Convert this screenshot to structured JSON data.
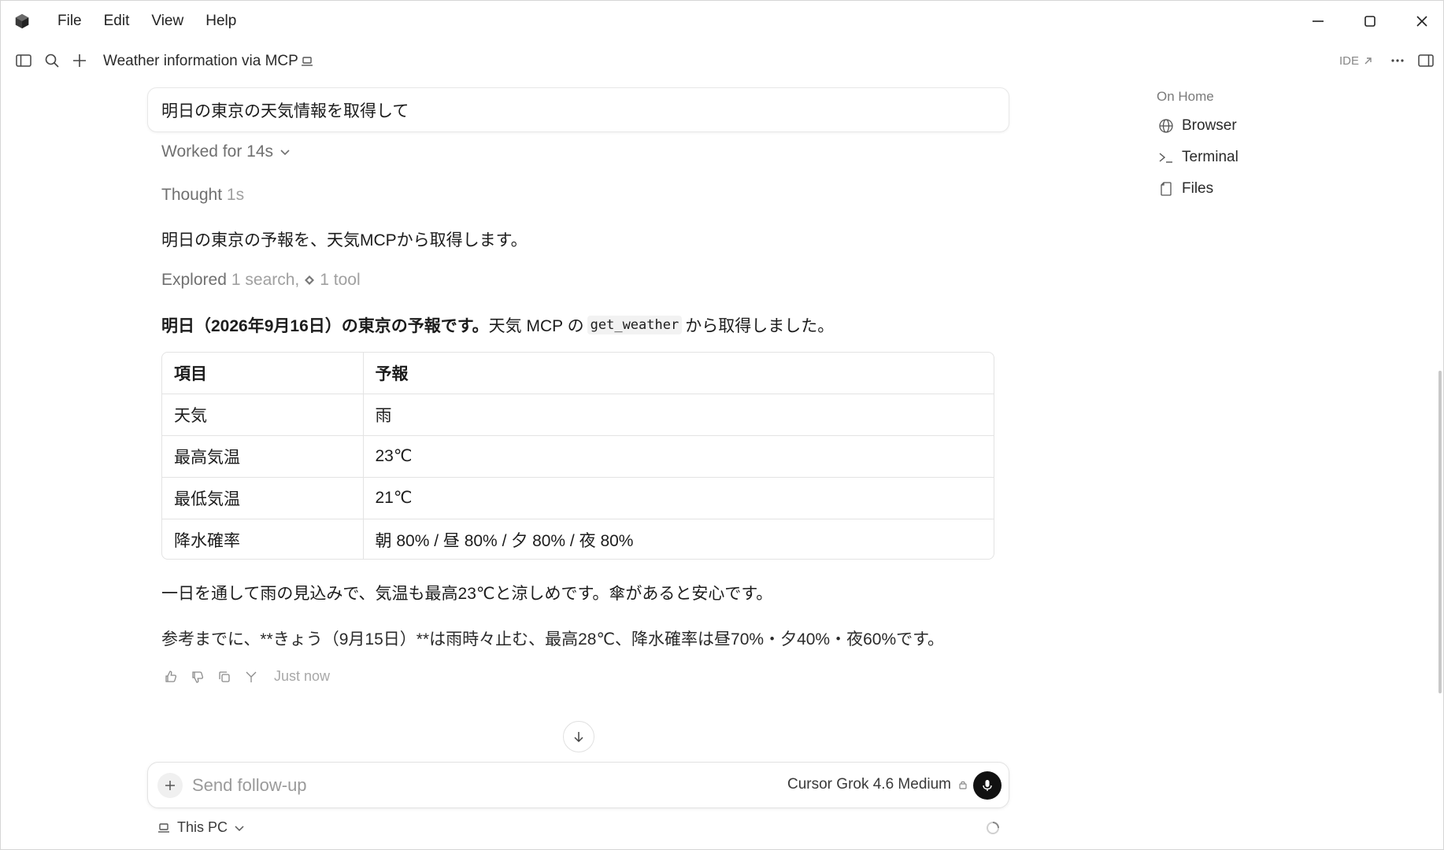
{
  "menubar": {
    "items": [
      "File",
      "Edit",
      "View",
      "Help"
    ]
  },
  "toolbar": {
    "title": "Weather information via MCP",
    "ide_label": "IDE"
  },
  "chat": {
    "prompt": "明日の東京の天気情報を取得して",
    "worked": "Worked for 14s",
    "thought_label": "Thought",
    "thought_duration": "1s",
    "para1": "明日の東京の予報を、天気MCPから取得します。",
    "explored_label": "Explored",
    "explored_search": "1 search,",
    "explored_tool": "1 tool",
    "answer_bold": "明日（2026年9月16日）の東京の予報です。",
    "answer_mid": "天気 MCP の",
    "answer_code": "get_weather",
    "answer_end": "から取得しました。",
    "table": {
      "headers": [
        "項目",
        "予報"
      ],
      "rows": [
        [
          "天気",
          "雨"
        ],
        [
          "最高気温",
          "23℃"
        ],
        [
          "最低気温",
          "21℃"
        ],
        [
          "降水確率",
          "朝 80% / 昼 80% / 夕 80% / 夜 80%"
        ]
      ]
    },
    "para2": "一日を通して雨の見込みで、気温も最高23℃と涼しめです。傘があると安心です。",
    "para3": "参考までに、**きょう（9月15日）**は雨時々止む、最高28℃、降水確率は昼70%・夕40%・夜60%です。",
    "timestamp": "Just now"
  },
  "composer": {
    "placeholder": "Send follow-up",
    "model": "Cursor Grok 4.6 Medium",
    "environment": "This PC"
  },
  "side_panel": {
    "heading": "On Home",
    "items": [
      "Browser",
      "Terminal",
      "Files"
    ]
  }
}
